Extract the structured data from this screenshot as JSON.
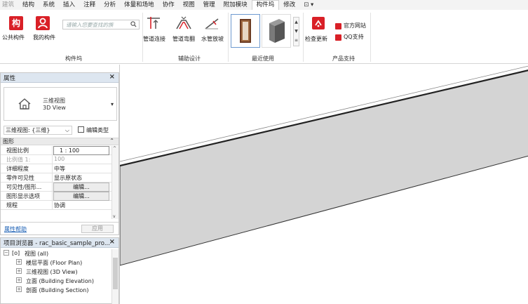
{
  "ribbon_tabs": [
    "建筑",
    "结构",
    "系统",
    "插入",
    "注释",
    "分析",
    "体量和场地",
    "协作",
    "视图",
    "管理",
    "附加模块",
    "构件坞",
    "修改",
    "⊡ ▾"
  ],
  "active_tab": "构件坞",
  "ribbon": {
    "goujianwu": {
      "btn1_label": "公共构件",
      "btn2_label": "我的构件",
      "search_placeholder": "请输入您要查找的族",
      "panel_title": "构件坞"
    },
    "fuzhu": {
      "btn1_label": "管道连接",
      "btn2_label": "管道弯翻",
      "btn3_label": "水管放坡",
      "panel_title": "辅助设计"
    },
    "recent": {
      "panel_title": "最近使用"
    },
    "support": {
      "update_label": "检查更新",
      "site_label": "官方网站",
      "qq_label": "QQ支持",
      "panel_title": "产品支持"
    }
  },
  "properties": {
    "title": "属性",
    "close": "×",
    "type_name_cn": "三维视图",
    "type_name_en": "3D View",
    "instance_selector": "三维视图: {三维}",
    "edit_type_label": "编辑类型",
    "group_label": "图形",
    "rows": [
      {
        "key": "视图比例",
        "value": "1 : 100",
        "kind": "box"
      },
      {
        "key": "比例值 1:",
        "value": "100",
        "kind": "dim"
      },
      {
        "key": "详细程度",
        "value": "中等",
        "kind": "text"
      },
      {
        "key": "零件可见性",
        "value": "显示原状态",
        "kind": "text"
      },
      {
        "key": "可见性/图形...",
        "value": "编辑...",
        "kind": "button"
      },
      {
        "key": "图形显示选项",
        "value": "编辑...",
        "kind": "button"
      },
      {
        "key": "规程",
        "value": "协调",
        "kind": "text"
      }
    ],
    "help_link": "属性帮助",
    "apply_label": "应用"
  },
  "browser": {
    "title": "项目浏览器 - rac_basic_sample_pro...",
    "close": "×",
    "root_label": "视图 (all)",
    "items": [
      "楼层平面 (Floor Plan)",
      "三维视图 (3D View)",
      "立面 (Building Elevation)",
      "剖面 (Building Section)"
    ]
  },
  "colors": {
    "accent_red": "#d92027",
    "panel_header": "#dde6f0",
    "link_blue": "#1a5fb4",
    "wall_fill": "#d4d4d4"
  }
}
